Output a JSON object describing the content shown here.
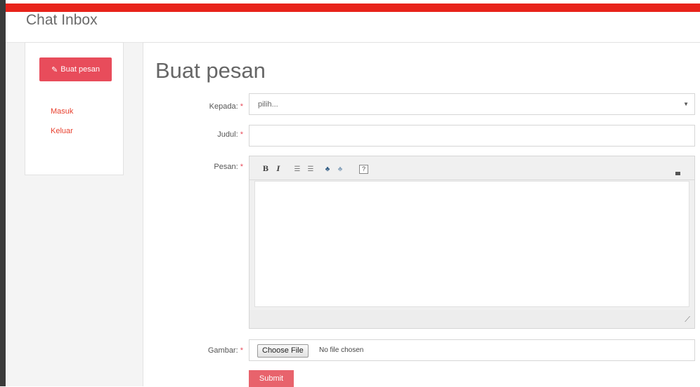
{
  "header": {
    "title": "Chat Inbox"
  },
  "sidebar": {
    "compose_label": "Buat pesan",
    "items": [
      {
        "label": "Masuk"
      },
      {
        "label": "Keluar"
      }
    ]
  },
  "form": {
    "title": "Buat pesan",
    "required_mark": "*",
    "fields": {
      "kepada": {
        "label": "Kepada:",
        "value": "pilih..."
      },
      "judul": {
        "label": "Judul:",
        "value": ""
      },
      "pesan": {
        "label": "Pesan:"
      },
      "gambar": {
        "label": "Gambar:",
        "button_label": "Choose File",
        "status": "No file chosen"
      }
    },
    "submit_label": "Submit"
  },
  "editor": {
    "toolbar": [
      {
        "name": "bold-icon",
        "glyph": "B"
      },
      {
        "name": "italic-icon",
        "glyph": "I"
      },
      {
        "name": "ordered-list-icon",
        "glyph": "☰"
      },
      {
        "name": "unordered-list-icon",
        "glyph": "☰"
      },
      {
        "name": "link-icon",
        "glyph": "♣"
      },
      {
        "name": "unlink-icon",
        "glyph": "♣"
      },
      {
        "name": "help-icon",
        "glyph": "?"
      }
    ]
  },
  "colors": {
    "accent_red": "#e8231b",
    "button_pink": "#e84c5b",
    "link_red": "#e8412f"
  }
}
